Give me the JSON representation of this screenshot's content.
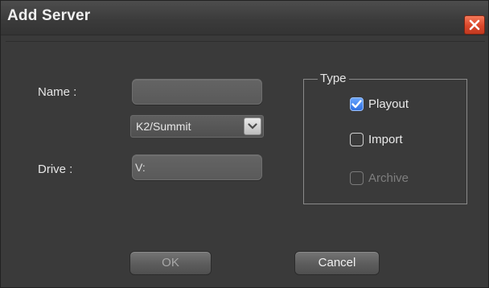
{
  "window": {
    "title": "Add Server",
    "close_icon": "close-x-icon"
  },
  "form": {
    "name_label": "Name :",
    "name_value": "",
    "server_type_value": "K2/Summit",
    "drive_label": "Drive :",
    "drive_value": "V:"
  },
  "type_group": {
    "legend": "Type",
    "options": [
      {
        "label": "Playout",
        "checked": true,
        "enabled": true
      },
      {
        "label": "Import",
        "checked": false,
        "enabled": true
      },
      {
        "label": "Archive",
        "checked": false,
        "enabled": false
      }
    ]
  },
  "buttons": {
    "ok_label": "OK",
    "ok_enabled": false,
    "cancel_label": "Cancel"
  },
  "colors": {
    "dialog_background": "#3a3a3a",
    "close_button": "#d9472b",
    "checkbox_checked": "#2f6fe0"
  }
}
